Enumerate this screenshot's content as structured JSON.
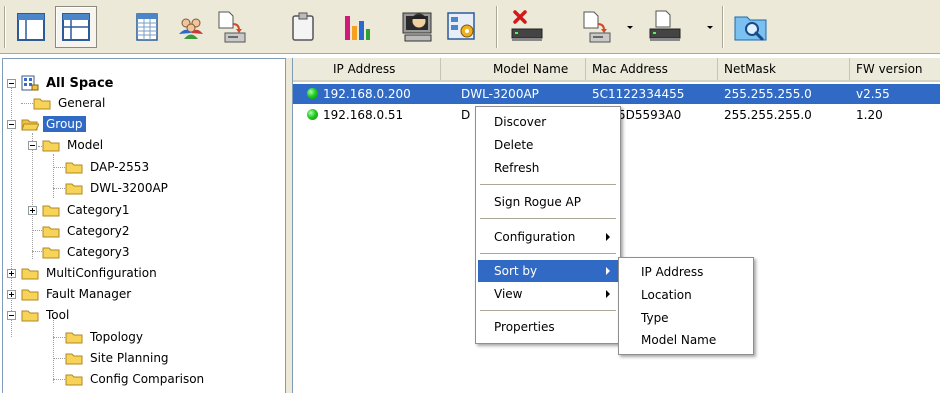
{
  "toolbar": {
    "buttons": [
      {
        "name": "layout-one-pane-icon"
      },
      {
        "name": "layout-two-pane-icon"
      },
      {
        "name": "spreadsheet-icon"
      },
      {
        "name": "users-icon"
      },
      {
        "name": "copy-to-device-icon"
      },
      {
        "name": "clipboard-icon"
      },
      {
        "name": "bar-chart-icon"
      },
      {
        "name": "monitor-person-icon"
      },
      {
        "name": "config-tool-icon"
      },
      {
        "name": "delete-device-icon"
      },
      {
        "name": "upload-file-icon"
      },
      {
        "name": "device-icon"
      },
      {
        "name": "folder-search-icon"
      }
    ]
  },
  "tree": {
    "root": "All Space",
    "nodes": [
      {
        "label": "General"
      },
      {
        "label": "Group"
      },
      {
        "label": "Model"
      },
      {
        "label": "DAP-2553"
      },
      {
        "label": "DWL-3200AP"
      },
      {
        "label": "Category1"
      },
      {
        "label": "Category2"
      },
      {
        "label": "Category3"
      },
      {
        "label": "MultiConfiguration"
      },
      {
        "label": "Fault Manager"
      },
      {
        "label": "Tool"
      },
      {
        "label": "Topology"
      },
      {
        "label": "Site Planning"
      },
      {
        "label": "Config Comparison"
      }
    ]
  },
  "table": {
    "columns": [
      "IP Address",
      "Model Name",
      "Mac Address",
      "NetMask",
      "FW version"
    ],
    "rows": [
      {
        "ip": "192.168.0.200",
        "model": "DWL-3200AP",
        "mac": "5C1122334455",
        "netmask": "255.255.255.0",
        "fw": "v2.55",
        "status_color": "#22cc22"
      },
      {
        "ip": "192.168.0.51",
        "model": "D",
        "mac": "5D5593A0",
        "netmask": "255.255.255.0",
        "fw": "1.20",
        "status_color": "#22cc22"
      }
    ]
  },
  "context_menu": {
    "items": [
      "Discover",
      "Delete",
      "Refresh",
      "Sign Rogue AP",
      "Configuration",
      "Sort by",
      "View",
      "Properties"
    ]
  },
  "sort_submenu": {
    "items": [
      "IP Address",
      "Location",
      "Type",
      "Model Name"
    ]
  },
  "colors": {
    "selection": "#316ac5",
    "toolbar_bg": "#ece9d8"
  }
}
